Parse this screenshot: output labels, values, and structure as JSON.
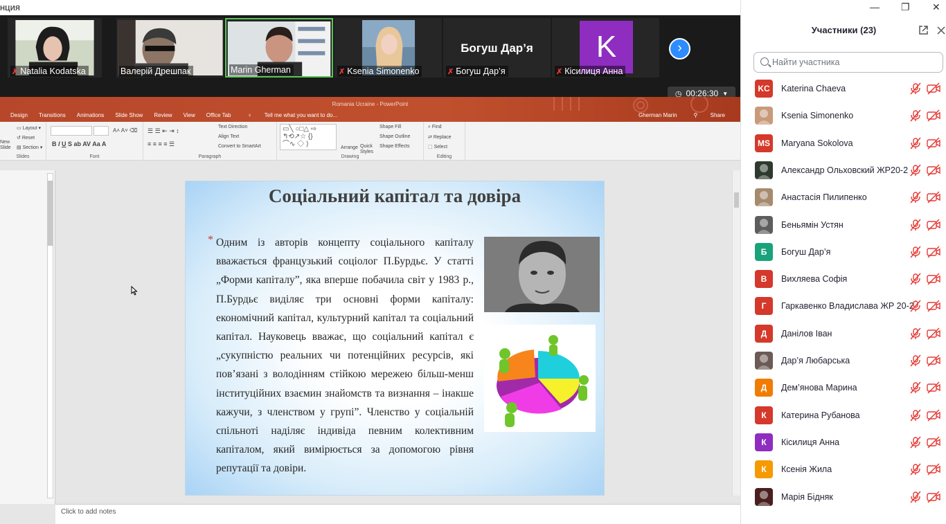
{
  "window": {
    "title_fragment": "нция",
    "min": "—",
    "max": "❐",
    "close": "✕"
  },
  "gallery": {
    "tiles": [
      {
        "name": "Natalia Kodatska",
        "muted": true
      },
      {
        "name": "Валерій Дрешпак",
        "muted": false
      },
      {
        "name": "Marin Gherman",
        "muted": false
      },
      {
        "name": "Ksenia Simonenko",
        "muted": true
      },
      {
        "name": "Богуш Дар’я",
        "muted": true,
        "big_name": "Богуш Дар’я"
      },
      {
        "name": "Кісилиця Анна",
        "muted": true,
        "initial": "K"
      }
    ],
    "next_icon": "chevron-right-icon",
    "timer": "00:26:30"
  },
  "ppt": {
    "window_title": "Romania Ucraine - PowerPoint",
    "tabs": [
      "Design",
      "Transitions",
      "Animations",
      "Slide Show",
      "Review",
      "View",
      "Office Tab",
      "Tell me what you want to do..."
    ],
    "user": "Gherman Marin",
    "share": "Share",
    "ribbon": {
      "slides": {
        "new_slide": "New Slide",
        "layout": "Layout",
        "reset": "Reset",
        "section": "Section",
        "label": "Slides"
      },
      "font_label": "Font",
      "paragraph": {
        "text_direction": "Text Direction",
        "align_text": "Align Text",
        "convert": "Convert to SmartArt",
        "label": "Paragraph"
      },
      "drawing": {
        "arrange": "Arrange",
        "quick_styles": "Quick Styles",
        "shape_fill": "Shape Fill",
        "shape_outline": "Shape Outline",
        "shape_effects": "Shape Effects",
        "label": "Drawing"
      },
      "editing": {
        "find": "Find",
        "replace": "Replace",
        "select": "Select",
        "label": "Editing"
      }
    },
    "slide": {
      "title": "Соціальний капітал та довіра",
      "bullet": "*",
      "body": "Одним із авторів концепту соціального капіталу вважається французький соціолог П.Бурдьє. У статті „Форми капіталу”, яка вперше побачила світ у 1983 р., П.Бурдьє виділяє три основні форми капіталу: економічний капітал, культурний капітал та соціальний капітал. Науковець вважає, що соціальний капітал є „сукупністю реальних чи потенційних ресурсів, які пов’язані з володінням стійкою мережею більш-менш інституційних взаємин знайомств та визнання – інакше кажучи, з членством у групі”. Членство у соціальній спільноті наділяє індивіда певним колективним капіталом, який вимірюється за допомогою рівня репутації та довіри."
    },
    "notes_placeholder": "Click to add notes"
  },
  "participants": {
    "title": "Участники (23)",
    "search_placeholder": "Найти участника",
    "list": [
      {
        "name": "Katerina Chaeva",
        "initials": "KC",
        "color": "#d4392b"
      },
      {
        "name": "Ksenia Simonenko",
        "initials": "",
        "color": "#c89a7a",
        "photo": true
      },
      {
        "name": "Maryana Sokolova",
        "initials": "MS",
        "color": "#d4392b"
      },
      {
        "name": "Александр Ольховский ЖР20-2",
        "initials": "",
        "color": "#2f3a2f",
        "photo": true
      },
      {
        "name": "Анастасія Пилипенко",
        "initials": "",
        "color": "#a58a6e",
        "photo": true
      },
      {
        "name": "Беньямін Устян",
        "initials": "",
        "color": "#5d5d5d",
        "photo": true
      },
      {
        "name": "Богуш Дар’я",
        "initials": "Б",
        "color": "#1aa37a"
      },
      {
        "name": "Вихляева Софія",
        "initials": "В",
        "color": "#d4392b"
      },
      {
        "name": "Гаркавенко Владислава ЖР 20-2",
        "initials": "Г",
        "color": "#d4392b"
      },
      {
        "name": "Данілов Іван",
        "initials": "Д",
        "color": "#d4392b"
      },
      {
        "name": "Дар’я Любарська",
        "initials": "",
        "color": "#6b5a55",
        "photo": true
      },
      {
        "name": "Дем’янова Марина",
        "initials": "Д",
        "color": "#f07c00"
      },
      {
        "name": "Катерина Рубанова",
        "initials": "К",
        "color": "#d4392b"
      },
      {
        "name": "Кісилиця Анна",
        "initials": "К",
        "color": "#8e2dbf"
      },
      {
        "name": "Ксенія Жила",
        "initials": "К",
        "color": "#f59a00"
      },
      {
        "name": "Марія Бідняк",
        "initials": "",
        "color": "#4a1f1f",
        "photo": true
      }
    ]
  },
  "colors": {
    "zoom_blue": "#2d8cff",
    "muted_red": "#e53935",
    "ppt_orange": "#b7472a"
  }
}
